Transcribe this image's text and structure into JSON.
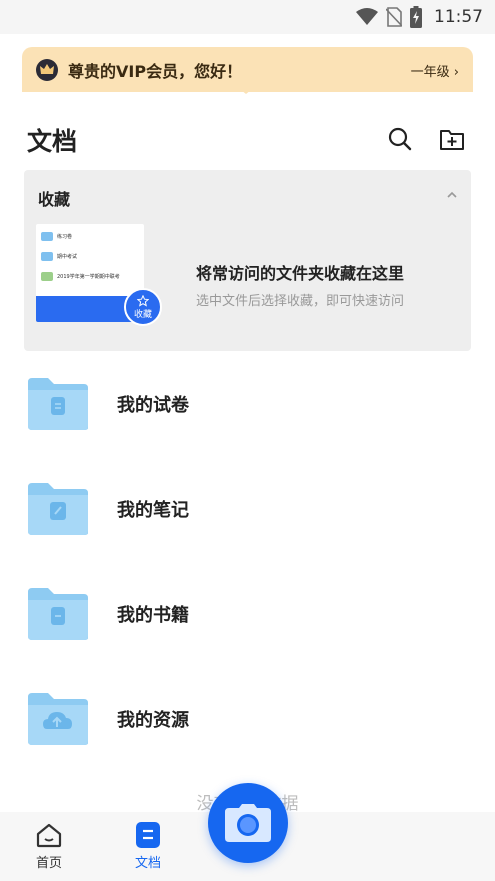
{
  "status_bar": {
    "time": "11:57",
    "icons": [
      "wifi-icon",
      "no-sim-icon",
      "battery-charging-icon"
    ]
  },
  "vip_banner": {
    "text": "尊贵的VIP会员，您好！",
    "grade": "一年级 ›",
    "icon": "crown-icon"
  },
  "header": {
    "title": "文档",
    "icons": [
      "search-icon",
      "add-folder-icon"
    ]
  },
  "favorites": {
    "title": "收藏",
    "message": "将常访问的文件夹收藏在这里",
    "hint": "选中文件后选择收藏，即可快速访问",
    "badge_label": "收藏",
    "thumbnail_rows": [
      "练习卷",
      "期中考试",
      "2019学年第一学期期中联考"
    ]
  },
  "folders": [
    {
      "label": "我的试卷",
      "icon": "document-icon"
    },
    {
      "label": "我的笔记",
      "icon": "notebook-icon"
    },
    {
      "label": "我的书籍",
      "icon": "book-icon"
    },
    {
      "label": "我的资源",
      "icon": "cloud-upload-icon"
    }
  ],
  "empty_text": "没有更多数据",
  "bottom_nav": {
    "home_label": "首页",
    "docs_label": "文档",
    "active": "文档"
  },
  "colors": {
    "accent": "#1667f0",
    "vip_bg": "#fbe2b6",
    "folder": "#8ecbf2"
  }
}
